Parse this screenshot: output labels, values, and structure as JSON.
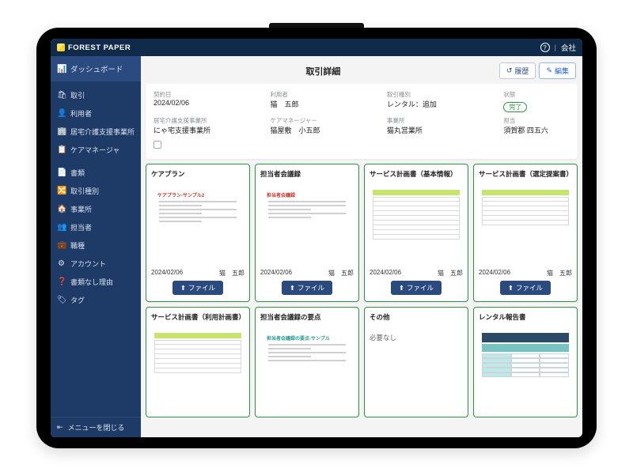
{
  "brand": "FOREST PAPER",
  "topbar": {
    "help": "?",
    "company_link": "会社"
  },
  "sidebar": {
    "dashboard": "ダッシュボード",
    "group1": [
      {
        "icon": "🛒",
        "label": "取引"
      },
      {
        "icon": "👤",
        "label": "利用者"
      },
      {
        "icon": "🏢",
        "label": "居宅介護支援事業所"
      },
      {
        "icon": "📋",
        "label": "ケアマネージャ"
      }
    ],
    "group2": [
      {
        "icon": "📄",
        "label": "書類"
      },
      {
        "icon": "🔀",
        "label": "取引種別"
      },
      {
        "icon": "🏠",
        "label": "事業所"
      },
      {
        "icon": "👥",
        "label": "担当者"
      },
      {
        "icon": "💼",
        "label": "職種"
      },
      {
        "icon": "⚙",
        "label": "アカウント"
      },
      {
        "icon": "?",
        "label": "書類なし理由"
      },
      {
        "icon": "🏷",
        "label": "タグ"
      }
    ],
    "collapse": "メニューを閉じる"
  },
  "page": {
    "title": "取引詳細",
    "history_btn": "履歴",
    "edit_btn": "編集"
  },
  "info": {
    "row1": [
      {
        "label": "契約日",
        "value": "2024/02/06"
      },
      {
        "label": "利用者",
        "value": "猫　五郎"
      },
      {
        "label": "取引種別",
        "value": "レンタル：追加"
      },
      {
        "label": "状態",
        "value": "完了",
        "pill": true
      }
    ],
    "row2": [
      {
        "label": "居宅介護支援事業所",
        "value": "にゃ宅支援事業所"
      },
      {
        "label": "ケアマネージャー",
        "value": "猫屋敷　小五郎"
      },
      {
        "label": "事業所",
        "value": "猫丸営業所"
      },
      {
        "label": "担当",
        "value": "須賀郡 四五六"
      }
    ]
  },
  "file_btn_label": "ファイル",
  "docs_row1": [
    {
      "title": "ケアプラン",
      "date": "2024/02/06",
      "who": "猫　五郎",
      "style": "careplan"
    },
    {
      "title": "担当者会議録",
      "date": "2024/02/06",
      "who": "猫　五郎",
      "style": "meeting"
    },
    {
      "title": "サービス計画書（基本情報）",
      "date": "2024/02/06",
      "who": "猫　五郎",
      "style": "plan-basic"
    },
    {
      "title": "サービス計画書（選定提案書）",
      "date": "2024/02/06",
      "who": "猫　五郎",
      "style": "plan-prop"
    }
  ],
  "docs_row2": [
    {
      "title": "サービス計画書（利用計画書）",
      "style": "plan-use"
    },
    {
      "title": "担当者会議録の要点",
      "style": "meeting-sum"
    },
    {
      "title": "その他",
      "note": "必要なし",
      "style": "none"
    },
    {
      "title": "レンタル報告書",
      "style": "rental"
    }
  ],
  "thumb_text": {
    "careplan": "ケアプラン-サンプル2",
    "meeting": "担当者会議録",
    "meeting_sum": "担当者会議録の要点-サンプル"
  }
}
